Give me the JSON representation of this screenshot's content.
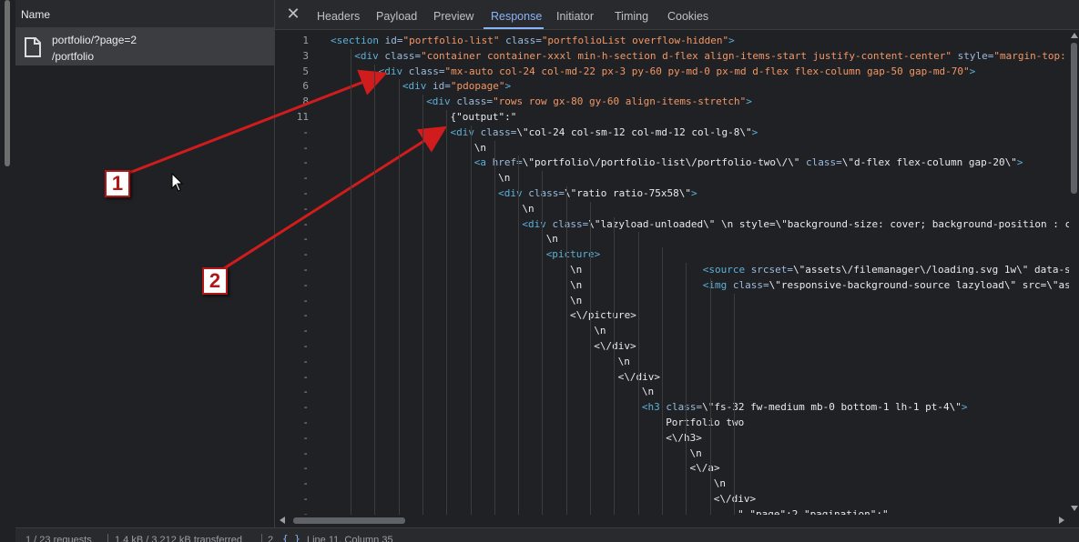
{
  "network": {
    "name_header": "Name",
    "request": {
      "name": "portfolio/?page=2",
      "path": "/portfolio"
    }
  },
  "tabs": [
    {
      "label": "Headers"
    },
    {
      "label": "Payload"
    },
    {
      "label": "Preview"
    },
    {
      "label": "Response",
      "active": true
    },
    {
      "label": "Initiator"
    },
    {
      "label": "Timing"
    },
    {
      "label": "Cookies"
    }
  ],
  "close_icon": "close-icon",
  "code_lines": [
    {
      "ln": "1",
      "tokens": [
        [
          "tag",
          "<section "
        ],
        [
          "attr",
          "id="
        ],
        [
          "val",
          "\"portfolio-list\""
        ],
        [
          "attr",
          " class="
        ],
        [
          "val",
          "\"portfolioList overflow-hidden\""
        ],
        [
          "tag",
          ">"
        ]
      ]
    },
    {
      "ln": "3",
      "tokens": [
        [
          "tag",
          "<div "
        ],
        [
          "attr",
          "class="
        ],
        [
          "val",
          "\"container container-xxxl min-h-section d-flex align-items-start justify-content-center\""
        ],
        [
          "attr",
          " style="
        ],
        [
          "val",
          "\"margin-top: "
        ]
      ]
    },
    {
      "ln": "5",
      "tokens": [
        [
          "tag",
          "<div "
        ],
        [
          "attr",
          "class="
        ],
        [
          "val",
          "\"mx-auto col-24 col-md-22 px-3 py-60 py-md-0 px-md d-flex flex-column gap-50 gap-md-70\""
        ],
        [
          "tag",
          ">"
        ]
      ]
    },
    {
      "ln": "6",
      "tokens": [
        [
          "tag",
          "<div "
        ],
        [
          "attr",
          "id="
        ],
        [
          "val",
          "\"pdopage\""
        ],
        [
          "tag",
          ">"
        ]
      ]
    },
    {
      "ln": "8",
      "tokens": [
        [
          "tag",
          "<div "
        ],
        [
          "attr",
          "class="
        ],
        [
          "val",
          "\"rows row gx-80 gy-60 align-items-stretch\""
        ],
        [
          "tag",
          ">"
        ]
      ]
    },
    {
      "ln": "11",
      "tokens": [
        [
          "str",
          "{\"output\":\""
        ]
      ]
    },
    {
      "ln": "-",
      "tokens": [
        [
          "tag",
          "<div "
        ],
        [
          "attr",
          "class="
        ],
        [
          "str",
          "\\\"col-24 col-sm-12 col-md-12 col-lg-8\\\""
        ],
        [
          "tag",
          ">"
        ]
      ]
    },
    {
      "ln": "-",
      "tokens": [
        [
          "str",
          "\\n"
        ]
      ]
    },
    {
      "ln": "-",
      "tokens": [
        [
          "tag",
          "<a "
        ],
        [
          "attr",
          "href="
        ],
        [
          "str",
          "\\\"portfolio\\/portfolio-list\\/portfolio-two\\/\\\""
        ],
        [
          "attr",
          " class="
        ],
        [
          "str",
          "\\\"d-flex flex-column gap-20\\\""
        ],
        [
          "tag",
          ">"
        ]
      ]
    },
    {
      "ln": "-",
      "tokens": [
        [
          "str",
          "\\n"
        ]
      ]
    },
    {
      "ln": "-",
      "tokens": [
        [
          "tag",
          "<div "
        ],
        [
          "attr",
          "class="
        ],
        [
          "str",
          "\\\"ratio ratio-75x58\\\""
        ],
        [
          "tag",
          ">"
        ]
      ]
    },
    {
      "ln": "-",
      "tokens": [
        [
          "str",
          "\\n"
        ]
      ]
    },
    {
      "ln": "-",
      "tokens": [
        [
          "tag",
          "<div "
        ],
        [
          "attr",
          "class="
        ],
        [
          "str",
          "\\\"lazyload-unloaded\\\" \\n style=\\\"background-size: cover; background-position : c"
        ]
      ]
    },
    {
      "ln": "-",
      "tokens": [
        [
          "str",
          "\\n"
        ]
      ]
    },
    {
      "ln": "-",
      "tokens": [
        [
          "tag",
          "<picture>"
        ]
      ]
    },
    {
      "ln": "-",
      "tokens": [
        [
          "str",
          "\\n                    "
        ],
        [
          "tag",
          "<source "
        ],
        [
          "attr",
          "srcset="
        ],
        [
          "str",
          "\\\"assets\\/filemanager\\/loading.svg 1w\\\" data-s"
        ]
      ]
    },
    {
      "ln": "-",
      "tokens": [
        [
          "str",
          "\\n                    "
        ],
        [
          "tag",
          "<img "
        ],
        [
          "attr",
          "class="
        ],
        [
          "str",
          "\\\"responsive-background-source lazyload\\\" src=\\\"as"
        ]
      ]
    },
    {
      "ln": "-",
      "tokens": [
        [
          "str",
          "\\n"
        ]
      ]
    },
    {
      "ln": "-",
      "tokens": [
        [
          "str",
          "<\\/picture>"
        ]
      ]
    },
    {
      "ln": "-",
      "tokens": [
        [
          "str",
          "\\n"
        ]
      ]
    },
    {
      "ln": "-",
      "tokens": [
        [
          "str",
          "<\\/div>"
        ]
      ]
    },
    {
      "ln": "-",
      "tokens": [
        [
          "str",
          "\\n"
        ]
      ]
    },
    {
      "ln": "-",
      "tokens": [
        [
          "str",
          "<\\/div>"
        ]
      ]
    },
    {
      "ln": "-",
      "tokens": [
        [
          "str",
          "\\n"
        ]
      ]
    },
    {
      "ln": "-",
      "tokens": [
        [
          "tag",
          "<h3 "
        ],
        [
          "attr",
          "class="
        ],
        [
          "str",
          "\\\"fs-32 fw-medium mb-0 bottom-1 lh-1 pt-4\\\""
        ],
        [
          "tag",
          ">"
        ]
      ]
    },
    {
      "ln": "-",
      "tokens": [
        [
          "str",
          "Portfolio two"
        ]
      ]
    },
    {
      "ln": "-",
      "tokens": [
        [
          "str",
          "<\\/h3>"
        ]
      ]
    },
    {
      "ln": "-",
      "tokens": [
        [
          "str",
          "\\n"
        ]
      ]
    },
    {
      "ln": "-",
      "tokens": [
        [
          "str",
          "<\\/a>"
        ]
      ]
    },
    {
      "ln": "-",
      "tokens": [
        [
          "str",
          "\\n"
        ]
      ]
    },
    {
      "ln": "-",
      "tokens": [
        [
          "str",
          "<\\/div>"
        ]
      ]
    },
    {
      "ln": "-",
      "tokens": [
        [
          "str",
          "\",\"page\":2,\"pagination\":\""
        ]
      ]
    }
  ],
  "code_indents": [
    0,
    1,
    2,
    3,
    4,
    5,
    5,
    6,
    6,
    7,
    7,
    8,
    8,
    9,
    9,
    10,
    10,
    10,
    10,
    11,
    11,
    12,
    12,
    13,
    13,
    14,
    14,
    15,
    15,
    16,
    16,
    17
  ],
  "status": {
    "requests": "1 / 23 requests",
    "transferred": "1.4 kB / 3,212 kB transferred",
    "extra": "2",
    "braces": "{ }",
    "cursor": "Line 11, Column 35"
  },
  "annotations": [
    {
      "label": "1"
    },
    {
      "label": "2"
    }
  ],
  "colors": {
    "background": "#202124",
    "accent": "#8ab4f8",
    "tag": "#5db0d7",
    "value": "#f29766",
    "annotation": "#d01c1c"
  }
}
